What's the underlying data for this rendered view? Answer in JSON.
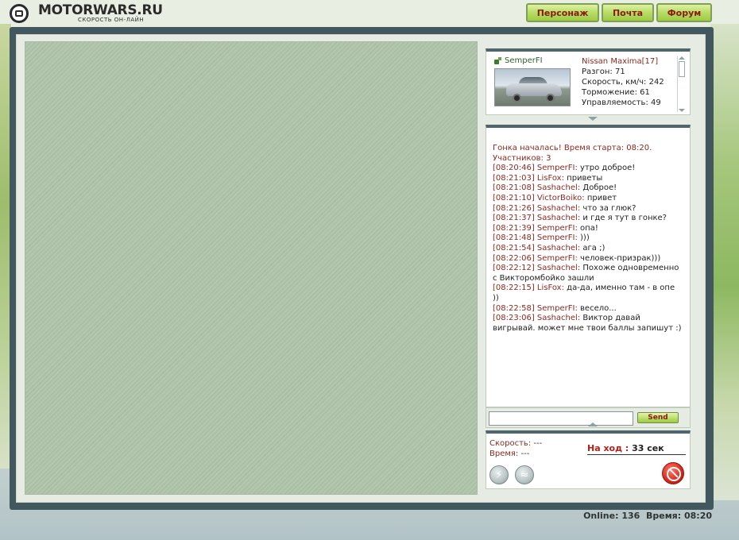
{
  "header": {
    "brand": "MOTORWARS.RU",
    "tagline": "СКОРОСТЬ ОН-ЛАЙН",
    "logo_icon": "steering-wheel-icon",
    "nav": [
      {
        "label": "Персонаж"
      },
      {
        "label": "Почта"
      },
      {
        "label": "Форум"
      }
    ]
  },
  "car": {
    "player_icon": "player-status-icon",
    "player": "SemperFI",
    "title": "Nissan Maxima[17]",
    "stats": [
      {
        "label": "Разгон:",
        "value": "71"
      },
      {
        "label": "Скорость, км/ч:",
        "value": "242"
      },
      {
        "label": "Торможение:",
        "value": "61"
      },
      {
        "label": "Управляемость:",
        "value": "49"
      }
    ]
  },
  "chat": {
    "system": [
      "Гонка началась! Время старта: 08:20.",
      "Участников: 3"
    ],
    "messages": [
      {
        "time": "[08:20:46]",
        "name": "SemperFI:",
        "text": "утро доброе!"
      },
      {
        "time": "[08:21:03]",
        "name": "LisFox:",
        "text": "приветы"
      },
      {
        "time": "[08:21:08]",
        "name": "Sashachel:",
        "text": "Доброе!"
      },
      {
        "time": "[08:21:10]",
        "name": "VictorBoiko:",
        "text": "привет"
      },
      {
        "time": "[08:21:26]",
        "name": "Sashachel:",
        "text": "что за глюк?"
      },
      {
        "time": "[08:21:37]",
        "name": "Sashachel:",
        "text": "и где я тут в гонке?"
      },
      {
        "time": "[08:21:39]",
        "name": "SemperFI:",
        "text": "опа!"
      },
      {
        "time": "[08:21:48]",
        "name": "SemperFI:",
        "text": ")))"
      },
      {
        "time": "[08:21:54]",
        "name": "Sashachel:",
        "text": "ага ;)"
      },
      {
        "time": "[08:22:06]",
        "name": "SemperFI:",
        "text": "человек-призрак)))"
      },
      {
        "time": "[08:22:12]",
        "name": "Sashachel:",
        "text": "Похоже одновременно с Викторомбойко зашли"
      },
      {
        "time": "[08:22:15]",
        "name": "LisFox:",
        "text": "да-да, именно там - в опе ))"
      },
      {
        "time": "[08:22:58]",
        "name": "SemperFI:",
        "text": "весело..."
      },
      {
        "time": "[08:23:06]",
        "name": "Sashachel:",
        "text": "Виктор давай вигрывай. может мне твои баллы запишут :)"
      }
    ],
    "input_value": "",
    "send_label": "Send"
  },
  "race": {
    "speed_label": "Скорость:",
    "speed_value": "---",
    "time_label": "Время:",
    "time_value": "---",
    "turn_label": "На ход :",
    "turn_value": "33 сек",
    "icons": {
      "boost": "lightning-icon",
      "signal": "signal-icon",
      "stop": "stop-icon"
    }
  },
  "footer": {
    "online_label": "Online:",
    "online_value": "136",
    "time_label": "Время:",
    "time_value": "08:20"
  }
}
